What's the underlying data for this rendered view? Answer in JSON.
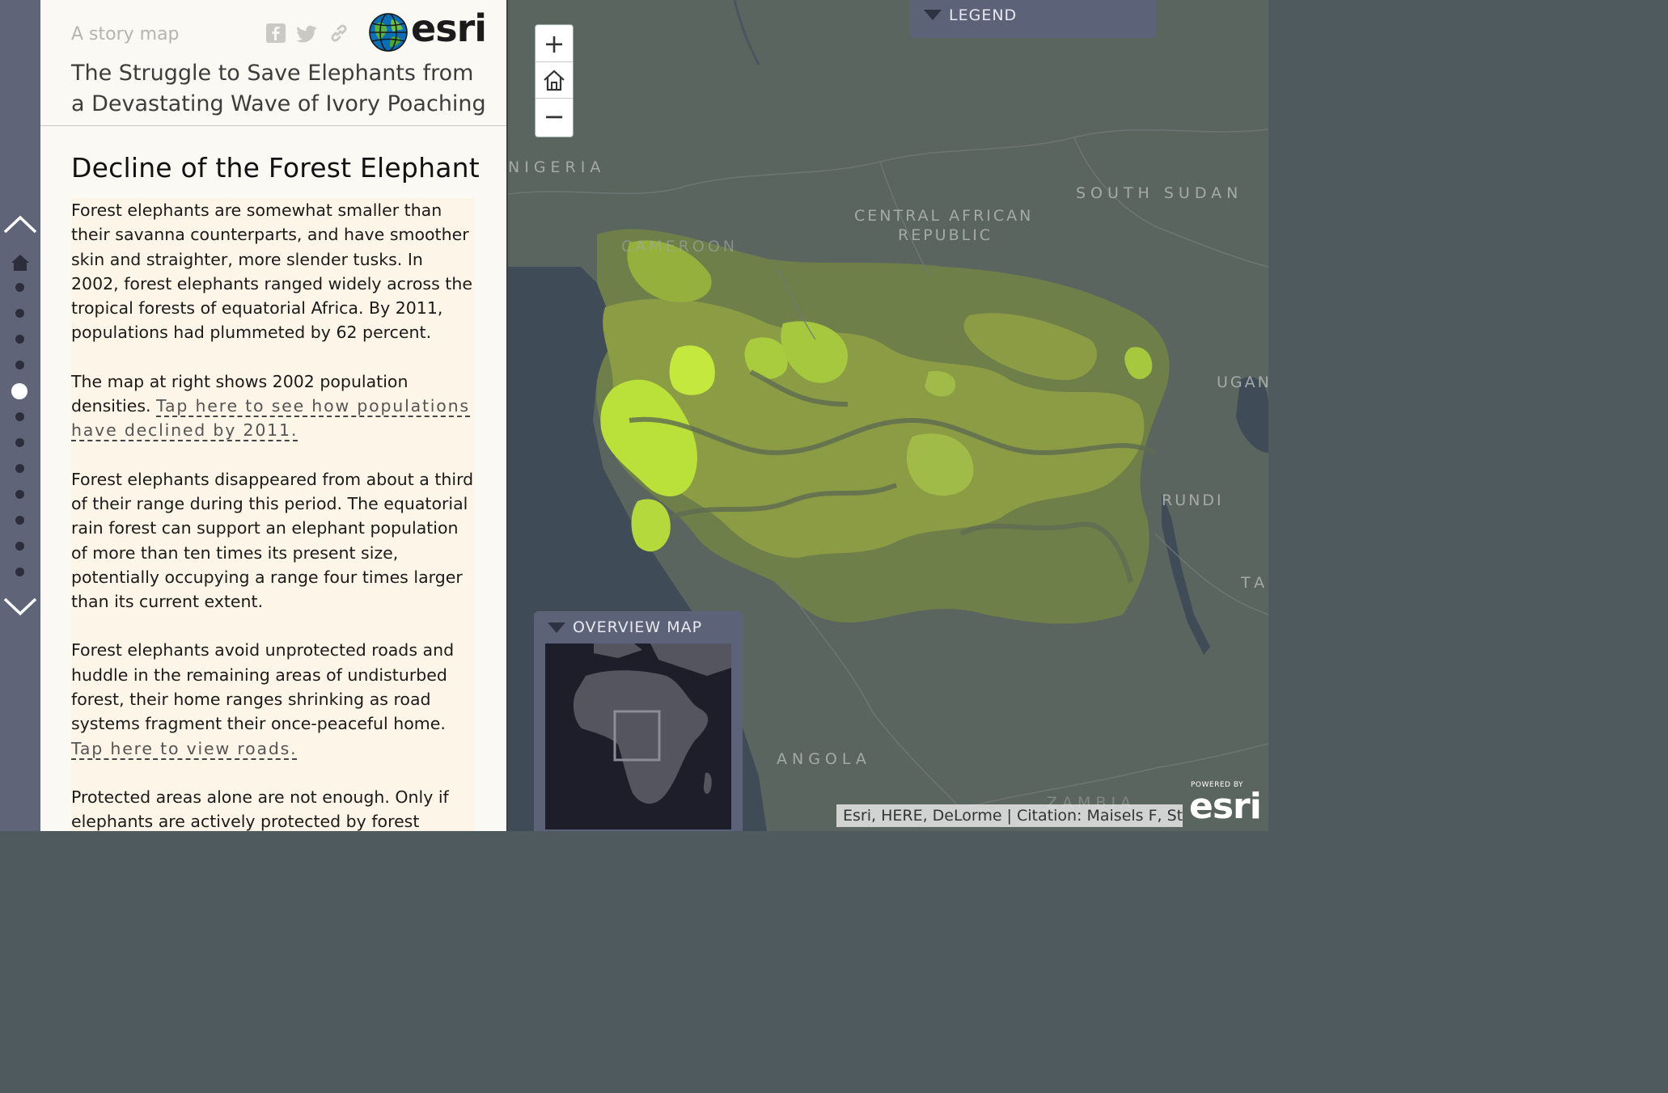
{
  "rail": {
    "dots": 12,
    "active_index": 4
  },
  "header": {
    "subtitle": "A story map",
    "brand": "esri",
    "title": "The Struggle to Save Elephants from a Devastating Wave of Ivory Poaching",
    "share_icons": [
      "facebook-icon",
      "twitter-icon",
      "link-icon"
    ]
  },
  "section": {
    "title": "Decline of the Forest Elephant",
    "p1": "Forest elephants are somewhat smaller than their savanna counterparts, and have smoother skin and straighter, more slender tusks. In 2002, forest elephants ranged widely across the tropical forests of equatorial Africa. By 2011, populations had plummeted by 62 percent.",
    "p2_text": "The map at right shows 2002 population densities. ",
    "p2_link": "Tap here to see how populations have declined by 2011.",
    "p3": "Forest elephants disappeared from about a third of their range during this period. The equatorial rain forest can support an elephant population of more than ten times its present size, potentially occupying a range four times larger than its current extent.",
    "p4_text": "Forest elephants avoid unprotected roads and huddle in the remaining areas of undisturbed forest, their home ranges shrinking as road systems fragment their once-peaceful home. ",
    "p4_link": "Tap here to view roads.",
    "p5": "Protected areas alone are not enough. Only if elephants are actively protected by forest"
  },
  "map": {
    "labels": {
      "nigeria": "NIGERIA",
      "south_sudan": "SOUTH SUDAN",
      "car_line1": "CENTRAL AFRICAN",
      "car_line2": "REPUBLIC",
      "cameroon": "CAMEROON",
      "uganda": "UGAN",
      "burundi": "RUNDI",
      "tanzania": "TA",
      "angola": "ANGOLA",
      "zambia": "ZAMBIA"
    },
    "zoom_in": "+",
    "zoom_out": "−",
    "legend_label": "LEGEND",
    "overview_label": "OVERVIEW MAP",
    "attribution": "Esri, HERE, DeLorme | Citation: Maisels F, St...",
    "powered_small": "POWERED BY",
    "powered_big": "esri"
  },
  "colors": {
    "rail": "#5f6479",
    "panel": "#faf9f3",
    "text_block": "#fdf5e7",
    "density_high": "#b9e13a",
    "density_mid": "#8fa544",
    "density_low": "#6e7f49",
    "map_land": "#5b655f",
    "map_water": "#3d4a55"
  }
}
